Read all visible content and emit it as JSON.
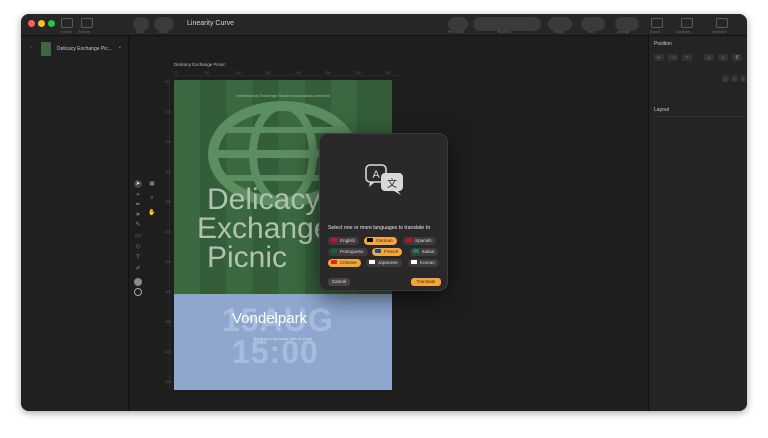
{
  "window": {
    "title": "Linearity Curve"
  },
  "toolbar": {
    "left_labels": [
      "Library",
      "Sidebar"
    ],
    "undo_label": "Undo",
    "zoom_label": "Zoom",
    "right_labels": [
      "Pen Mode",
      "Boolean",
      "Group",
      "Trim",
      "Arrange",
      "Export",
      "Assistant",
      "Inspector"
    ]
  },
  "sidebar": {
    "layers": [
      {
        "label": "Delicacy Exchange Pic..."
      }
    ]
  },
  "canvas": {
    "artboard_name": "Delicacy Exchange Picnic",
    "ruler_h": [
      "0",
      "50",
      "100",
      "150",
      "200",
      "250",
      "300",
      "350"
    ],
    "ruler_v": [
      "50",
      "100",
      "150",
      "200",
      "250",
      "300",
      "350",
      "400",
      "450",
      "500",
      "550",
      "600"
    ],
    "poster": {
      "top_text": "International Exchange Student Association presents",
      "title_lines": [
        "Delicacy",
        "Exchange",
        "Picnic"
      ],
      "date": "15AUG",
      "time": "15:00",
      "venue": "Vondelpark",
      "details": "Bring your favourite dish to share"
    }
  },
  "inspector": {
    "position_header": "Position",
    "layout_header": "Layout"
  },
  "dialog": {
    "prompt": "Select one or more languages to translate to",
    "languages": [
      {
        "label": "English",
        "selected": false,
        "flag_color": "#c8102e"
      },
      {
        "label": "German",
        "selected": true,
        "flag_color": "#000000"
      },
      {
        "label": "Spanish",
        "selected": false,
        "flag_color": "#c60b1e"
      },
      {
        "label": "Portuguese",
        "selected": false,
        "flag_color": "#046a38"
      },
      {
        "label": "French",
        "selected": true,
        "flag_color": "#0055a4"
      },
      {
        "label": "Italian",
        "selected": false,
        "flag_color": "#009246"
      },
      {
        "label": "Chinese",
        "selected": true,
        "flag_color": "#de2910"
      },
      {
        "label": "Japanese",
        "selected": false,
        "flag_color": "#ffffff"
      },
      {
        "label": "Korean",
        "selected": false,
        "flag_color": "#ffffff"
      }
    ],
    "cancel_label": "Cancel",
    "translate_label": "Translate"
  },
  "colors": {
    "accent": "#f5a53a",
    "window_bg": "#1c1c1c",
    "poster_green": "#3a6840",
    "poster_blue": "#8fa6cf"
  }
}
